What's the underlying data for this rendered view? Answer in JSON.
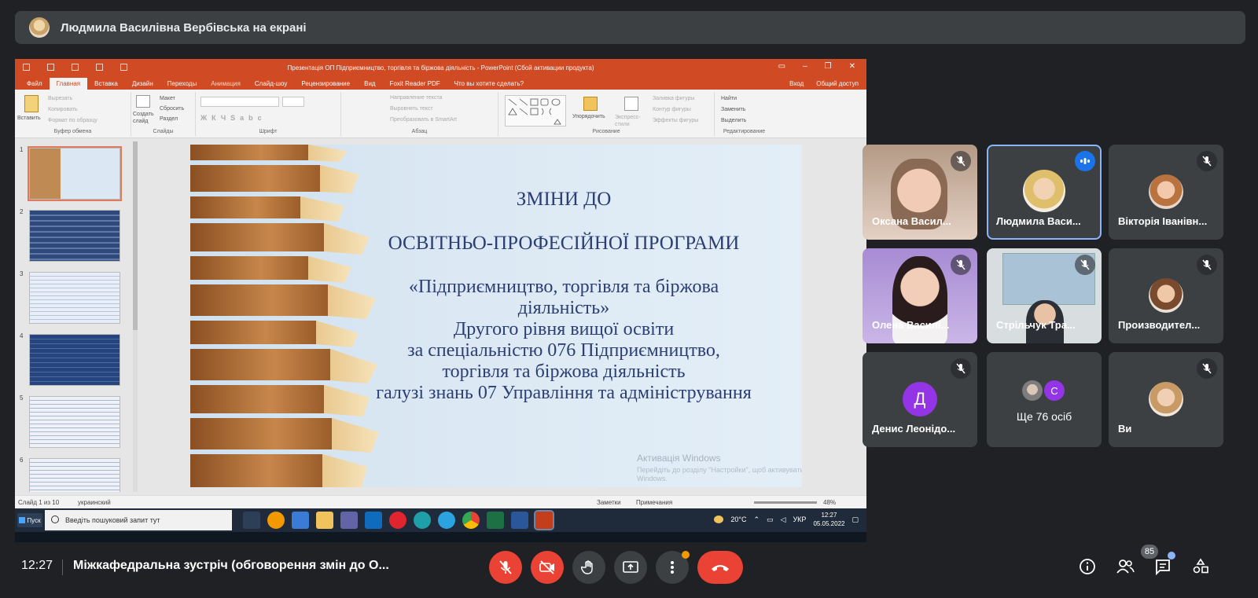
{
  "presenter_bar": {
    "text": "Людмила Василівна Вербівська на екрані"
  },
  "ppt": {
    "title": "Презентація ОП Підприємництво, торгівля та біржова діяльність - PowerPoint (Сбой активации продукта)",
    "tabs": [
      "Файл",
      "Главная",
      "Вставка",
      "Дизайн",
      "Переходы",
      "Анимация",
      "Слайд-шоу",
      "Рецензирование",
      "Вид",
      "Foxit Reader PDF",
      "Что вы хотите сделать?"
    ],
    "active_tab": "Главная",
    "tab_right": [
      "Вход",
      "Общий доступ"
    ],
    "ribbon": {
      "paste": "Вставить",
      "cut": "Вырезать",
      "copy": "Копировать",
      "format_painter": "Формат по образцу",
      "clipboard": "Буфер обмена",
      "new_slide": "Создать слайд",
      "layout": "Макет",
      "reset": "Сбросить",
      "section": "Раздел",
      "slides": "Слайды",
      "font": "Шрифт",
      "paragraph": "Абзац",
      "text_direction": "Направление текста",
      "align_text": "Выровнять текст",
      "convert_smartart": "Преобразовать в SmartArt",
      "arrange": "Упорядочить",
      "quick_styles": "Экспресс-стили",
      "shape_fill": "Заливка фигуры",
      "shape_outline": "Контур фигуры",
      "shape_effects": "Эффекты фигуры",
      "drawing": "Рисование",
      "find": "Найти",
      "replace": "Заменить",
      "select": "Выделить",
      "editing": "Редактирование"
    },
    "thumb_numbers": [
      "1",
      "2",
      "3",
      "4",
      "5",
      "6"
    ],
    "slide": {
      "line1": "ЗМІНИ ДО",
      "line2": "ОСВІТНЬО-ПРОФЕСІЙНОЇ ПРОГРАМИ",
      "line3": "«Підприємництво, торгівля та біржова",
      "line4": "діяльність»",
      "line5": "Другого рівня вищої освіти",
      "line6": "за спеціальністю 076 Підприємництво,",
      "line7": "торгівля та біржова діяльність",
      "line8": "галузі знань 07 Управління та адміністрування"
    },
    "watermark": "Активація Windows",
    "watermark_sub": "Перейдіть до розділу \"Настройки\", щоб активувати Windows.",
    "status": {
      "slide": "Слайд 1 из 10",
      "lang": "украинский",
      "notes": "Заметки",
      "comments": "Примечания",
      "zoom": "48%"
    }
  },
  "taskbar": {
    "start": "Пуск",
    "search_placeholder": "Введіть пошуковий запит тут",
    "temp": "20°C",
    "lang": "УКР",
    "time": "12:27",
    "date": "05.05.2022"
  },
  "participants": [
    {
      "name": "Оксана Васил...",
      "muted": true
    },
    {
      "name": "Людмила Васи...",
      "speaking": true
    },
    {
      "name": "Вікторія Іванівн...",
      "muted": true
    },
    {
      "name": "Олена Василі...",
      "muted": true
    },
    {
      "name": "Стрільчук Тра...",
      "muted": true
    },
    {
      "name": "Производител...",
      "muted": true
    },
    {
      "name": "Денис Леонідо...",
      "letter": "Д",
      "muted": true
    },
    {
      "name": "Ще 76 осіб",
      "letter": "С"
    },
    {
      "name": "Ви",
      "muted": true
    }
  ],
  "bottom": {
    "time": "12:27",
    "title": "Міжкафедральна зустріч (обговорення змін до О...",
    "people_count": "85"
  },
  "colors": {
    "end_call": "#ea4335",
    "speaking": "#1a73e8",
    "ppt_accent": "#d04a23"
  }
}
